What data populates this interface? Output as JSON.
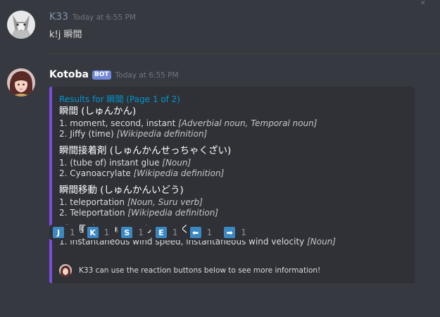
{
  "messages": [
    {
      "username": "K33",
      "timestamp": "Today at 6:55 PM",
      "text": "k!j 瞬間"
    },
    {
      "username": "Kotoba",
      "bot_tag": "BOT",
      "timestamp": "Today at 6:55 PM",
      "embed": {
        "accent_color": "#7b4ddf",
        "title": "Results for 瞬間 (Page 1 of 2)",
        "entries": [
          {
            "head": "瞬間 (しゅんかん)",
            "defs": [
              {
                "text": "1. moment, second, instant ",
                "tag": "[Adverbial noun, Temporal noun]"
              },
              {
                "text": "2. Jiffy (time) ",
                "tag": "[Wikipedia definition]"
              }
            ]
          },
          {
            "head": "瞬間接着剤 (しゅんかんせっちゃくざい)",
            "defs": [
              {
                "text": "1. (tube of) instant glue ",
                "tag": "[Noun]"
              },
              {
                "text": "2. Cyanoacrylate ",
                "tag": "[Wikipedia definition]"
              }
            ]
          },
          {
            "head": "瞬間移動 (しゅんかんいどう)",
            "defs": [
              {
                "text": "1. teleportation ",
                "tag": "[Noun, Suru verb]"
              },
              {
                "text": "2. Teleportation ",
                "tag": "[Wikipedia definition]"
              }
            ]
          },
          {
            "head": "瞬間風速 (しゅんかんふうそく)",
            "defs": [
              {
                "text": "1. instantaneous wind speed, instantaneous wind velocity ",
                "tag": "[Noun]"
              }
            ]
          }
        ],
        "footer": "K33 can use the reaction buttons below to see more information!"
      }
    }
  ],
  "reactions": [
    {
      "emoji": "J",
      "count": "1"
    },
    {
      "emoji": "K",
      "count": "1"
    },
    {
      "emoji": "S",
      "count": "1"
    },
    {
      "emoji": "E",
      "count": "1"
    },
    {
      "emoji": "⬅",
      "count": "1"
    },
    {
      "emoji": "➡",
      "count": "1"
    }
  ]
}
